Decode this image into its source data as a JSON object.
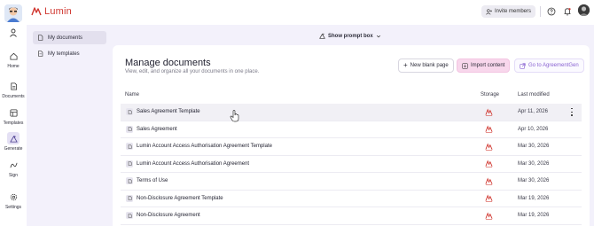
{
  "brand": {
    "name": "Lumin",
    "color": "#d0362f"
  },
  "header": {
    "invite_label": "Invite members",
    "icons": [
      "help-icon",
      "bell-icon",
      "user-avatar"
    ]
  },
  "rail": {
    "items": [
      {
        "label": "Home",
        "icon": "home-icon"
      },
      {
        "label": "Documents",
        "icon": "documents-icon"
      },
      {
        "label": "Templates",
        "icon": "templates-icon"
      },
      {
        "label": "Generate",
        "icon": "generate-icon",
        "active": true
      },
      {
        "label": "Sign",
        "icon": "sign-icon"
      },
      {
        "label": "Settings",
        "icon": "settings-icon"
      }
    ]
  },
  "subnav": {
    "items": [
      {
        "label": "My documents",
        "active": true
      },
      {
        "label": "My templates"
      }
    ]
  },
  "prompt": {
    "toggle_label": "Show prompt box"
  },
  "main": {
    "title": "Manage documents",
    "subtitle": "View, edit, and organize all your documents in one place.",
    "buttons": {
      "new_blank": "New blank page",
      "import": "Import content",
      "agreement_gen": "Go to AgreementGen"
    },
    "columns": {
      "name": "Name",
      "storage": "Storage",
      "modified": "Last modified"
    },
    "documents": [
      {
        "name": "Sales Agreement Template",
        "modified": "Apr 11, 2026"
      },
      {
        "name": "Sales Agreement",
        "modified": "Apr 10, 2026"
      },
      {
        "name": "Lumin Account Access Authorisation Agreement Template",
        "modified": "Mar 30, 2026"
      },
      {
        "name": "Lumin Account Access Authorisation Agreement",
        "modified": "Mar 30, 2026"
      },
      {
        "name": "Terms of Use",
        "modified": "Mar 30, 2026"
      },
      {
        "name": "Non-Disclosure Agreement Template",
        "modified": "Mar 19, 2026"
      },
      {
        "name": "Non-Disclosure Agreement",
        "modified": "Mar 19, 2026"
      }
    ]
  },
  "colors": {
    "accent": "#8a63d2",
    "import_bg": "#f8d7ec",
    "background": "#f3f1fb"
  }
}
